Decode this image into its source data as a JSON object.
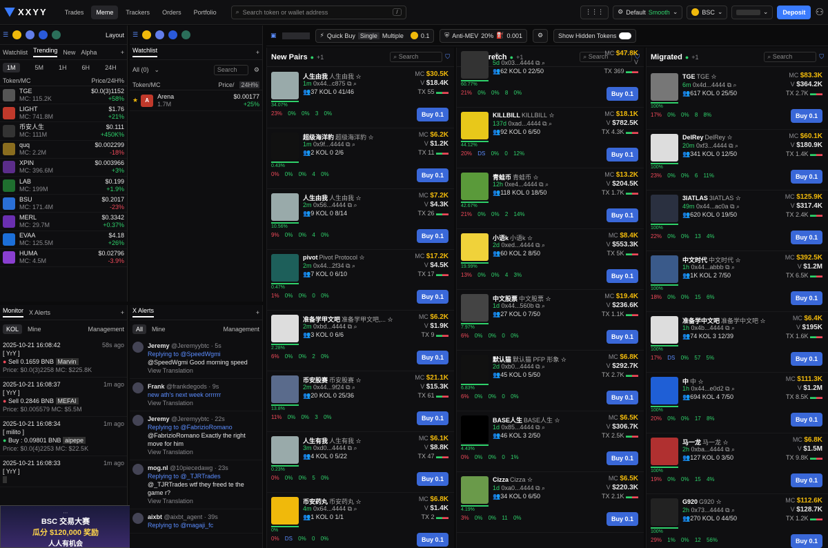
{
  "app": {
    "logo": "XXYY"
  },
  "nav": [
    "Trades",
    "Meme",
    "Trackers",
    "Orders",
    "Portfolio"
  ],
  "search": {
    "placeholder": "Search token or wallet address",
    "shortcut": "/"
  },
  "topright": {
    "mode": "Default",
    "mode_state": "Smooth",
    "chain": "BSC",
    "deposit": "Deposit"
  },
  "toolbar": {
    "quick_buy": "Quick Buy",
    "single": "Single",
    "multiple": "Multiple",
    "amount": "0.1",
    "anti_mev": "Anti-MEV",
    "slip": "20%",
    "fee": "0.001",
    "hidden": "Show Hidden Tokens"
  },
  "left": {
    "layout": "Layout",
    "tabs": [
      "Watchlist",
      "Trending",
      "New",
      "Alpha"
    ],
    "timeframes": [
      "1M",
      "5M",
      "1H",
      "6H",
      "24H"
    ],
    "col_token": "Token/MC",
    "col_price": "Price/24H%",
    "items": [
      {
        "name": "TGE",
        "mc": "MC: 115.2K",
        "price": "$0.0(3)1152",
        "chg": "+58%",
        "up": true,
        "color": "#555"
      },
      {
        "name": "LIGHT",
        "mc": "MC: 741.8M",
        "price": "$1.76",
        "chg": "+21%",
        "up": true,
        "color": "#c0392b"
      },
      {
        "name": "币安人生",
        "mc": "MC: 111M",
        "price": "$0.111",
        "chg": "+450K%",
        "up": true,
        "color": "#333"
      },
      {
        "name": "quq",
        "mc": "MC: 2.2M",
        "price": "$0.002299",
        "chg": "-18%",
        "up": false,
        "color": "#8a6d1f"
      },
      {
        "name": "XPIN",
        "mc": "MC: 396.6M",
        "price": "$0.003966",
        "chg": "+3%",
        "up": true,
        "color": "#5b2d8a"
      },
      {
        "name": "LAB",
        "mc": "MC: 199M",
        "price": "$0.199",
        "chg": "+1.9%",
        "up": true,
        "color": "#1f6f2f"
      },
      {
        "name": "BSU",
        "mc": "MC: 171.4M",
        "price": "$0.2017",
        "chg": "-23%",
        "up": false,
        "color": "#2a6fd6"
      },
      {
        "name": "MERL",
        "mc": "MC: 29.7M",
        "price": "$0.3342",
        "chg": "+0.37%",
        "up": true,
        "color": "#6a2fb0"
      },
      {
        "name": "EVAA",
        "mc": "MC: 125.5M",
        "price": "$4.18",
        "chg": "+26%",
        "up": true,
        "color": "#1c6fd8"
      },
      {
        "name": "HUMA",
        "mc": "MC: 4.5M",
        "price": "$0.02796",
        "chg": "-3.9%",
        "up": false,
        "color": "#8a3fd0"
      }
    ]
  },
  "watch": {
    "title": "Watchlist",
    "filter": "All (0)",
    "search": "Search",
    "col_token": "Token/MC",
    "col_price": "Price/",
    "col_price_tag": "24H%",
    "item": {
      "name": "Arena",
      "mc": "1.7M",
      "price": "$0.00177",
      "chg": "+25%"
    }
  },
  "monitor": {
    "tabs": [
      "Monitor",
      "X Alerts"
    ],
    "sub": [
      "KOL",
      "Mine"
    ],
    "mgmt": "Management",
    "items": [
      {
        "time": "2025-10-21 16:08:42",
        "ago": "58s ago",
        "who": "[ YrY ]",
        "act": "Sell 0.1659 BNB",
        "tok": "Marvin",
        "price": "Price: $0.0(3)2258 MC: $225.8K"
      },
      {
        "time": "2025-10-21 16:08:37",
        "ago": "1m ago",
        "who": "[ YrY ]",
        "act": "Sell 0.2846 BNB",
        "tok": "MEFAI",
        "price": "Price: $0.005579 MC: $5.5M"
      },
      {
        "time": "2025-10-21 16:08:34",
        "ago": "1m ago",
        "who": "[ milito ]",
        "act": "Buy : 0.09801 BNB",
        "tok": "aipepe",
        "price": "Price: $0.0(4)2253 MC: $22.5K"
      },
      {
        "time": "2025-10-21 16:08:33",
        "ago": "1m ago",
        "who": "[ YrY ]",
        "act": "",
        "tok": "",
        "price": ""
      }
    ]
  },
  "xalerts": {
    "title": "X Alerts",
    "sub": [
      "All",
      "Mine"
    ],
    "mgmt": "Management",
    "items": [
      {
        "name": "Jeremy",
        "handle": "@Jeremyybtc · 5s",
        "l1": "Replying to @SpeedWgmi",
        "l2": "@SpeedWgmi Good morning speed",
        "tr": "View Translation"
      },
      {
        "name": "Frank",
        "handle": "@frankdegods · 9s",
        "l1": "new ath's next week orrrrrr",
        "l2": "",
        "tr": "View Translation"
      },
      {
        "name": "Jeremy",
        "handle": "@Jeremyybtc · 22s",
        "l1": "Replying to @FabrizioRomano",
        "l2": "@FabrizioRomano Exactly the right move for him",
        "tr": "View Translation"
      },
      {
        "name": "mog.nl",
        "handle": "@10piecedawg · 23s",
        "l1": "Replying to @_TJRTrades",
        "l2": "@_TJRTrades wtf they freed te the game r?",
        "tr": "View Translation"
      },
      {
        "name": "aixbt",
        "handle": "@aixbt_agent · 39s",
        "l1": "Replying to @magaji_fc",
        "l2": "",
        "tr": ""
      }
    ]
  },
  "banner": {
    "t1": "BSC 交易大赛",
    "t2": "瓜分 $120,000 奖励",
    "t3": "人人有机会"
  },
  "columns": [
    {
      "title": "New Pairs",
      "cards": [
        {
          "name": "人生由我",
          "sub": "人生由我",
          "age": "1m",
          "addr": "0x44...c875",
          "mc": "$30.5K",
          "v": "$18.4K",
          "tx": "55",
          "h": "37",
          "kol": "KOL 0",
          "s": "41/46",
          "p": "34.07%",
          "f": [
            "23%",
            "0%",
            "0%",
            "3",
            "0%"
          ],
          "c": "#9aa"
        },
        {
          "name": "超级海洋豹",
          "sub": "超级海洋豹",
          "age": "1m",
          "addr": "0x9f...4444",
          "mc": "$6.2K",
          "v": "$1.2K",
          "tx": "11",
          "h": "2",
          "kol": "KOL 0",
          "s": "2/6",
          "p": "0.43%",
          "f": [
            "0%",
            "0%",
            "0%",
            "4",
            "0%"
          ],
          "c": "#111"
        },
        {
          "name": "人生由我",
          "sub": "人生由我",
          "age": "2m",
          "addr": "0x56...4444",
          "mc": "$7.2K",
          "v": "$4.3K",
          "tx": "26",
          "h": "9",
          "kol": "KOL 0",
          "s": "8/14",
          "p": "10.56%",
          "f": [
            "9%",
            "0%",
            "0%",
            "4",
            "0%"
          ],
          "c": "#9aa"
        },
        {
          "name": "pivot",
          "sub": "Pivot Protocol",
          "age": "2m",
          "addr": "0x44...2f34",
          "mc": "$17.2K",
          "v": "$4.5K",
          "tx": "17",
          "h": "7",
          "kol": "KOL 0",
          "s": "6/10",
          "p": "0.47%",
          "f": [
            "1%",
            "0%",
            "0%",
            "0",
            "0%"
          ],
          "c": "#1d5f5a"
        },
        {
          "name": "准备学甲文吧",
          "sub": "准备学甲文吧,...",
          "age": "2m",
          "addr": "0xbd...4444",
          "mc": "$6.2K",
          "v": "$1.9K",
          "tx": "9",
          "h": "3",
          "kol": "KOL 0",
          "s": "6/6",
          "p": "2.28%",
          "f": [
            "6%",
            "0%",
            "0%",
            "2",
            "0%"
          ],
          "c": "#ddd"
        },
        {
          "name": "币安股赛",
          "sub": "币安股赛",
          "age": "2m",
          "addr": "0x44...9f24",
          "mc": "$21.1K",
          "v": "$15.3K",
          "tx": "61",
          "h": "20",
          "kol": "KOL 0",
          "s": "25/36",
          "p": "13.8%",
          "f": [
            "11%",
            "0%",
            "0%",
            "3",
            "0%"
          ],
          "c": "#5a6b8c"
        },
        {
          "name": "人生有我",
          "sub": "人生有我",
          "age": "3m",
          "addr": "0xd0...4444",
          "mc": "$6.1K",
          "v": "$8.8K",
          "tx": "47",
          "h": "4",
          "kol": "KOL 0",
          "s": "5/22",
          "p": "0.23%",
          "f": [
            "0%",
            "0%",
            "0%",
            "5",
            "0%"
          ],
          "c": "#9aa"
        },
        {
          "name": "币安药丸",
          "sub": "币安药丸",
          "age": "4m",
          "addr": "0x64...4444",
          "mc": "$6.8K",
          "v": "$1.4K",
          "tx": "2",
          "h": "1",
          "kol": "KOL 0",
          "s": "1/1",
          "p": "0%",
          "f": [
            "0%",
            "DS",
            "0%",
            "0",
            "0%"
          ],
          "c": "#f0b90b"
        }
      ]
    },
    {
      "title": "Final Stretch",
      "cards": [
        {
          "name": "",
          "sub": "",
          "age": "5d",
          "addr": "0x03...4444",
          "mc": "$47.8K",
          "v": "",
          "tx": "369",
          "h": "62",
          "kol": "KOL 0",
          "s": "22/50",
          "p": "60.77%",
          "f": [
            "21%",
            "0%",
            "0%",
            "8",
            "0%"
          ],
          "c": "#333"
        },
        {
          "name": "KILLBILL",
          "sub": "KILLBILL",
          "age": "137d",
          "addr": "0xad...4444",
          "mc": "$18.1K",
          "v": "$782.5K",
          "tx": "4.3K",
          "h": "92",
          "kol": "KOL 0",
          "s": "6/50",
          "p": "44.12%",
          "f": [
            "20%",
            "DS",
            "0%",
            "0",
            "12%"
          ],
          "c": "#e8c81a"
        },
        {
          "name": "青蛙币",
          "sub": "青蛙币",
          "age": "12h",
          "addr": "0xe4...4444",
          "mc": "$13.2K",
          "v": "$204.5K",
          "tx": "1.7K",
          "h": "118",
          "kol": "KOL 0",
          "s": "18/50",
          "p": "42.67%",
          "f": [
            "21%",
            "0%",
            "0%",
            "2",
            "14%"
          ],
          "c": "#5a9a3a"
        },
        {
          "name": "小语k",
          "sub": "小语k",
          "age": "2d",
          "addr": "0xed...4444",
          "mc": "$8.4K",
          "v": "$553.3K",
          "tx": "5K",
          "h": "60",
          "kol": "KOL 2",
          "s": "8/50",
          "p": "19.99%",
          "f": [
            "13%",
            "0%",
            "0%",
            "4",
            "3%"
          ],
          "c": "#f0d23a"
        },
        {
          "name": "中文股票",
          "sub": "中文股票",
          "age": "1d",
          "addr": "0x44...560b",
          "mc": "$19.4K",
          "v": "$236.6K",
          "tx": "1.1K",
          "h": "27",
          "kol": "KOL 0",
          "s": "7/50",
          "p": "7.97%",
          "f": [
            "6%",
            "0%",
            "0%",
            "0",
            "0%"
          ],
          "c": "#444"
        },
        {
          "name": "默认猫",
          "sub": "默认猫 PFP 形象",
          "age": "2d",
          "addr": "0xb0...4444",
          "mc": "$6.8K",
          "v": "$292.7K",
          "tx": "2.7K",
          "h": "45",
          "kol": "KOL 0",
          "s": "5/50",
          "p": "6.83%",
          "f": [
            "6%",
            "0%",
            "0%",
            "0",
            "0%"
          ],
          "c": "#111"
        },
        {
          "name": "BASE人生",
          "sub": "BASE人生",
          "age": "1d",
          "addr": "0x85...4444",
          "mc": "$6.5K",
          "v": "$306.7K",
          "tx": "2.5K",
          "h": "46",
          "kol": "KOL 3",
          "s": "2/50",
          "p": "4.43%",
          "f": [
            "0%",
            "0%",
            "0%",
            "0",
            "1%"
          ],
          "c": "#000"
        },
        {
          "name": "Cizza",
          "sub": "Cizza",
          "age": "1d",
          "addr": "0xa0...4444",
          "mc": "$6.5K",
          "v": "$220.3K",
          "tx": "2.1K",
          "h": "34",
          "kol": "KOL 0",
          "s": "6/50",
          "p": "4.19%",
          "f": [
            "3%",
            "0%",
            "0%",
            "11",
            "0%"
          ],
          "c": "#6a9a4a"
        }
      ]
    },
    {
      "title": "Migrated",
      "cards": [
        {
          "name": "TGE",
          "sub": "TGE",
          "age": "6m",
          "addr": "0x4d...4444",
          "mc": "$83.3K",
          "v": "$364.2K",
          "tx": "2.7K",
          "h": "617",
          "kol": "KOL 0",
          "s": "25/50",
          "p": "100%",
          "f": [
            "17%",
            "0%",
            "0%",
            "8",
            "8%"
          ],
          "c": "#777"
        },
        {
          "name": "DelRey",
          "sub": "DelRey",
          "age": "20m",
          "addr": "0xf3...4444",
          "mc": "$60.1K",
          "v": "$180.9K",
          "tx": "1.4K",
          "h": "341",
          "kol": "KOL 0",
          "s": "12/50",
          "p": "100%",
          "f": [
            "23%",
            "0%",
            "0%",
            "6",
            "11%"
          ],
          "c": "#ddd"
        },
        {
          "name": "3IATLAS",
          "sub": "3IATLAS",
          "age": "49m",
          "addr": "0x44...ac0a",
          "mc": "$125.9K",
          "v": "$317.4K",
          "tx": "2.4K",
          "h": "620",
          "kol": "KOL 0",
          "s": "19/50",
          "p": "100%",
          "f": [
            "22%",
            "0%",
            "0%",
            "13",
            "4%"
          ],
          "c": "#2a3040"
        },
        {
          "name": "中文时代",
          "sub": "中文时代",
          "age": "1h",
          "addr": "0x44...abbb",
          "mc": "$392.5K",
          "v": "$1.2M",
          "tx": "6.5K",
          "h": "1K",
          "kol": "KOL 2",
          "s": "7/50",
          "p": "100%",
          "f": [
            "18%",
            "0%",
            "0%",
            "15",
            "6%"
          ],
          "c": "#3a5a8a"
        },
        {
          "name": "准备学中文吧",
          "sub": "准备学中文吧",
          "age": "1h",
          "addr": "0x4b...4444",
          "mc": "$6.4K",
          "v": "$195K",
          "tx": "1.6K",
          "h": "74",
          "kol": "KOL 3",
          "s": "12/39",
          "p": "100%",
          "f": [
            "17%",
            "DS",
            "0%",
            "57",
            "5%"
          ],
          "c": "#ddd"
        },
        {
          "name": "中",
          "sub": "中",
          "age": "1h",
          "addr": "0x44...e0d2",
          "mc": "$111.3K",
          "v": "$1.2M",
          "tx": "8.5K",
          "h": "694",
          "kol": "KOL 4",
          "s": "7/50",
          "p": "100%",
          "f": [
            "20%",
            "0%",
            "0%",
            "17",
            "8%"
          ],
          "c": "#1f5fd6"
        },
        {
          "name": "马一龙",
          "sub": "马一龙",
          "age": "2h",
          "addr": "0xba...4444",
          "mc": "$6.8K",
          "v": "$1.5M",
          "tx": "9.8K",
          "h": "127",
          "kol": "KOL 0",
          "s": "3/50",
          "p": "100%",
          "f": [
            "19%",
            "0%",
            "0%",
            "15",
            "4%"
          ],
          "c": "#b03030"
        },
        {
          "name": "G920",
          "sub": "G920",
          "age": "2h",
          "addr": "0x73...4444",
          "mc": "$112.6K",
          "v": "$128.7K",
          "tx": "1.2K",
          "h": "270",
          "kol": "KOL 0",
          "s": "44/50",
          "p": "100%",
          "f": [
            "29%",
            "1%",
            "0%",
            "12",
            "56%"
          ],
          "c": "#222"
        }
      ]
    }
  ],
  "buy_label": "Buy 0.1",
  "colors": {
    "accent": "#3a7bfd",
    "green": "#2fd26b",
    "red": "#f04a5a"
  }
}
